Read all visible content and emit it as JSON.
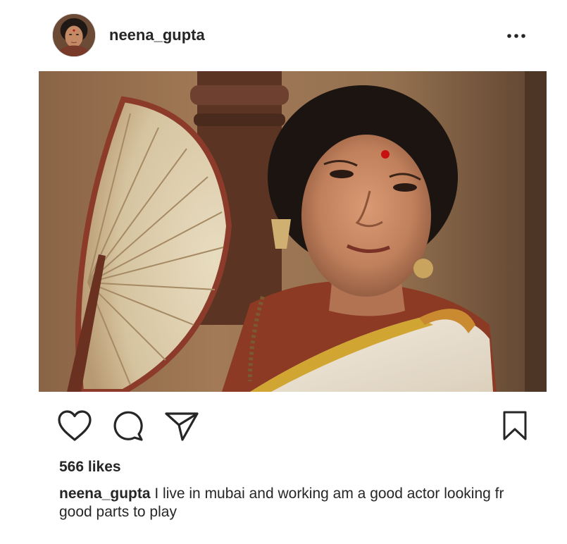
{
  "post": {
    "username": "neena_gupta",
    "avatar_icon": "profile-photo",
    "more_icon": "more-options-icon",
    "photo_alt": "Neena Gupta",
    "actions": {
      "like_icon": "heart-icon",
      "comment_icon": "comment-icon",
      "share_icon": "paper-plane-icon",
      "save_icon": "bookmark-icon"
    },
    "likes_text": "566 likes",
    "caption": {
      "username": "neena_gupta",
      "text": "I live in mubai and working am a good actor looking fr good parts to play"
    }
  },
  "colors": {
    "text": "#262626",
    "background": "#ffffff",
    "icon": "#262626"
  }
}
